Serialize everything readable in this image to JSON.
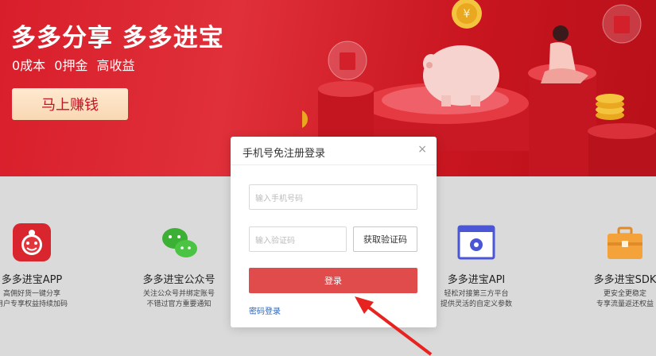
{
  "hero": {
    "title": "多多分享 多多进宝",
    "subtitle": "0成本 0押金 高收益",
    "cta": "马上赚钱",
    "bg_color": "#d81e2a"
  },
  "features": [
    {
      "name": "多多进宝APP",
      "desc1": "高佣好货一键分享",
      "desc2": "用户专享权益持续加码",
      "icon": "app-icon"
    },
    {
      "name": "多多进宝公众号",
      "desc1": "关注公众号并绑定账号",
      "desc2": "不错过官方重要通知",
      "icon": "wechat-icon"
    },
    {
      "name": "多多进宝API",
      "desc1": "轻松对接第三方平台",
      "desc2": "提供灵活的自定义参数",
      "icon": "api-gear-icon"
    },
    {
      "name": "多多进宝SDK",
      "desc1": "更安全更稳定",
      "desc2": "专享流量返还权益",
      "icon": "briefcase-icon"
    }
  ],
  "modal": {
    "title": "手机号免注册登录",
    "close": "×",
    "phone_placeholder": "输入手机号码",
    "code_placeholder": "输入验证码",
    "get_code": "获取验证码",
    "login": "登录",
    "password_login": "密码登录"
  },
  "colors": {
    "accent": "#e04b4b",
    "link": "#2b66b8",
    "annotation_arrow": "#e8231f"
  }
}
